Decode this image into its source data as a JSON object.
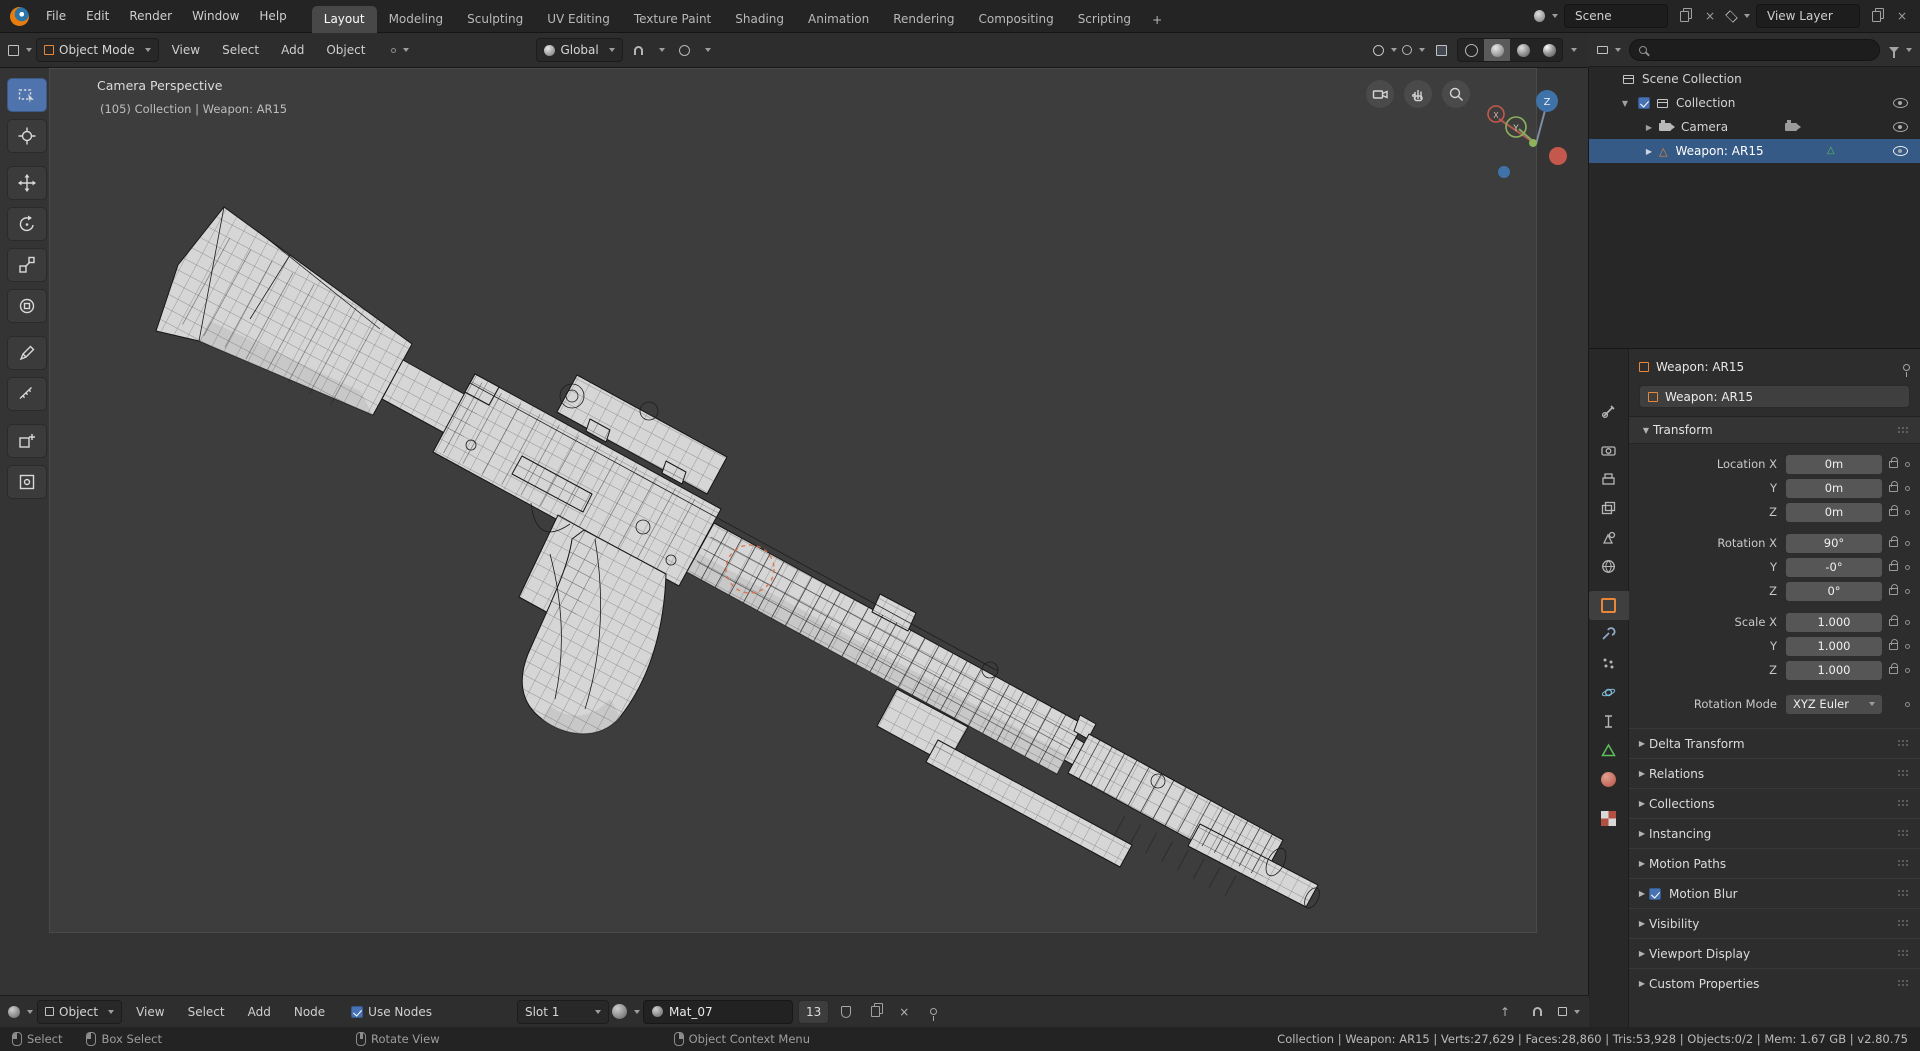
{
  "topbar": {
    "menus": [
      "File",
      "Edit",
      "Render",
      "Window",
      "Help"
    ],
    "workspaces": [
      "Layout",
      "Modeling",
      "Sculpting",
      "UV Editing",
      "Texture Paint",
      "Shading",
      "Animation",
      "Rendering",
      "Compositing",
      "Scripting"
    ],
    "add_workspace": "+",
    "scene": {
      "value": "Scene"
    },
    "view_layer": {
      "value": "View Layer"
    }
  },
  "viewport_header": {
    "mode": "Object Mode",
    "menus": [
      "View",
      "Select",
      "Add",
      "Object"
    ],
    "orientation": "Global"
  },
  "viewport": {
    "title": "Camera Perspective",
    "info": "(105) Collection | Weapon: AR15",
    "axis": {
      "x": "X",
      "y": "Y",
      "z": "Z"
    }
  },
  "outliner": {
    "rows": [
      {
        "label": "Scene Collection"
      },
      {
        "label": "Collection"
      },
      {
        "label": "Camera"
      },
      {
        "label": "Weapon: AR15"
      }
    ]
  },
  "properties": {
    "breadcrumb": "Weapon: AR15",
    "name_field": "Weapon: AR15",
    "transform": {
      "title": "Transform",
      "rows": [
        {
          "label": "Location X",
          "value": "0m"
        },
        {
          "label": "Y",
          "value": "0m"
        },
        {
          "label": "Z",
          "value": "0m"
        },
        {
          "label": "Rotation X",
          "value": "90°"
        },
        {
          "label": "Y",
          "value": "-0°"
        },
        {
          "label": "Z",
          "value": "0°"
        },
        {
          "label": "Scale X",
          "value": "1.000"
        },
        {
          "label": "Y",
          "value": "1.000"
        },
        {
          "label": "Z",
          "value": "1.000"
        }
      ],
      "rotation_mode_label": "Rotation Mode",
      "rotation_mode_value": "XYZ Euler"
    },
    "panels": [
      {
        "label": "Delta Transform"
      },
      {
        "label": "Relations"
      },
      {
        "label": "Collections"
      },
      {
        "label": "Instancing"
      },
      {
        "label": "Motion Paths"
      },
      {
        "label": "Motion Blur",
        "checkbox": true
      },
      {
        "label": "Visibility"
      },
      {
        "label": "Viewport Display"
      },
      {
        "label": "Custom Properties"
      }
    ]
  },
  "shader_bar": {
    "editor_type": "Object",
    "menus": [
      "View",
      "Select",
      "Add",
      "Node"
    ],
    "use_nodes": "Use Nodes",
    "slot": "Slot 1",
    "material": "Mat_07",
    "users": "13"
  },
  "statusbar": {
    "hints": [
      {
        "label": "Select"
      },
      {
        "label": "Box Select"
      },
      {
        "label": "Rotate View"
      },
      {
        "label": "Object Context Menu"
      }
    ],
    "stats": "Collection | Weapon: AR15 | Verts:27,629 | Faces:28,860 | Tris:53,928 | Objects:0/2 | Mem: 1.67 GB | v2.80.75"
  },
  "icons": {
    "triangle_right": "▶",
    "triangle_down": "▼",
    "triangle_outline": "△",
    "close": "×",
    "arrow_up": "↑"
  }
}
